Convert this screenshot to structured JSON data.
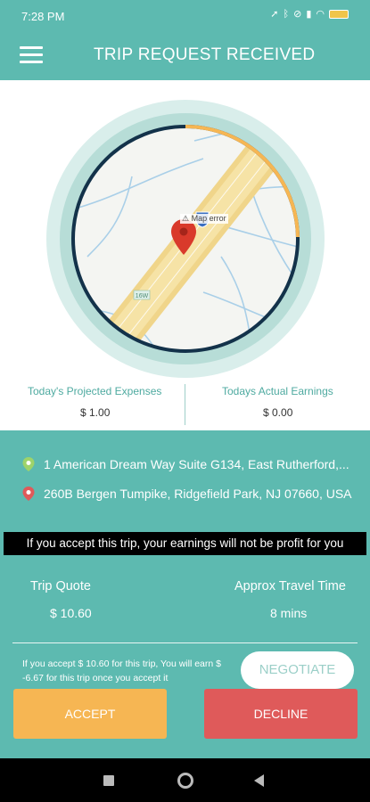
{
  "status_bar": {
    "time": "7:28 PM",
    "icons": [
      "location-arrow-icon",
      "bluetooth-icon",
      "mute-icon",
      "signal-icon",
      "wifi-icon",
      "battery-icon"
    ]
  },
  "app_bar": {
    "title": "TRIP REQUEST RECEIVED"
  },
  "map": {
    "warning": "Map error",
    "highway_label": "16W",
    "shield_label": "95",
    "progress_color": "#f6b653"
  },
  "stats": {
    "expenses_label": "Today's Projected Expenses",
    "expenses_value": "$ 1.00",
    "earnings_label": "Todays Actual Earnings",
    "earnings_value": "$ 0.00"
  },
  "addresses": {
    "pickup": "1 American Dream Way Suite G134, East Rutherford,...",
    "dropoff": "260B Bergen Tumpike, Ridgefield Park, NJ 07660, USA"
  },
  "warning_banner": "If you accept this trip, your earnings will not be profit for you",
  "quote": {
    "trip_quote_label": "Trip Quote",
    "trip_quote_value": "$ 10.60",
    "travel_time_label": "Approx Travel Time",
    "travel_time_value": "8 mins"
  },
  "note": "If you accept $ 10.60 for this trip, You will earn $ -6.67 for this trip once you accept it",
  "buttons": {
    "negotiate": "NEGOTIATE",
    "accept": "ACCEPT",
    "decline": "DECLINE"
  },
  "colors": {
    "primary": "#5dbab0",
    "accept": "#f6b653",
    "decline": "#df5a5a"
  }
}
